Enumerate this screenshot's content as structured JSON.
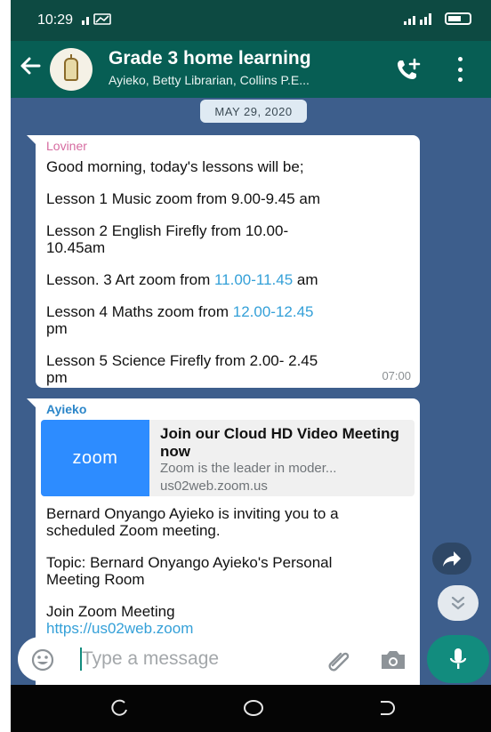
{
  "status_bar": {
    "time": "10:29"
  },
  "header": {
    "title": "Grade 3 home learning",
    "members": "Ayieko, Betty Librarian, Collins P.E..."
  },
  "chat": {
    "date_chip": "MAY 29, 2020",
    "messages": [
      {
        "sender": "Loviner",
        "sender_color": "#d66ba0",
        "lines": [
          "Good morning, today's lessons will be;",
          "Lesson 1 Music zoom from 9.00-9.45 am",
          "Lesson 2 English Firefly from 10.00-",
          "10.45am",
          "Lesson. 3 Art zoom from ",
          "11.00-11.45",
          " am",
          "Lesson 4 Maths zoom from ",
          "12.00-12.45",
          "pm",
          "Lesson  5 Science Firefly from 2.00- 2.45",
          "pm"
        ],
        "time": "07:00"
      },
      {
        "sender": "Ayieko",
        "sender_color": "#2b86c9",
        "link_preview": {
          "thumb_text": "zoom",
          "title": "Join our Cloud HD Video Meeting now",
          "description": "Zoom is the leader in moder...",
          "domain": "us02web.zoom.us"
        },
        "lines": [
          "Bernard Onyango Ayieko is inviting you to a",
          "scheduled Zoom meeting.",
          "Topic: Bernard Onyango Ayieko's Personal",
          "Meeting Room",
          "Join Zoom Meeting",
          "https://us02web.zoom"
        ]
      }
    ]
  },
  "composer": {
    "placeholder": "Type a message"
  },
  "icons": {
    "back": "arrow-left-icon",
    "group_avatar": "lamp-icon",
    "add_call": "phone-plus-icon",
    "menu": "more-vertical-icon",
    "forward": "forward-icon",
    "scroll_down": "chevron-double-down-icon",
    "emoji": "emoji-icon",
    "attach": "paperclip-icon",
    "camera": "camera-icon",
    "mic": "microphone-icon"
  },
  "colors": {
    "appbar": "#075e54",
    "chat_background": "#3d5e8c",
    "accent": "#128c7e",
    "link": "#34a0d8"
  }
}
